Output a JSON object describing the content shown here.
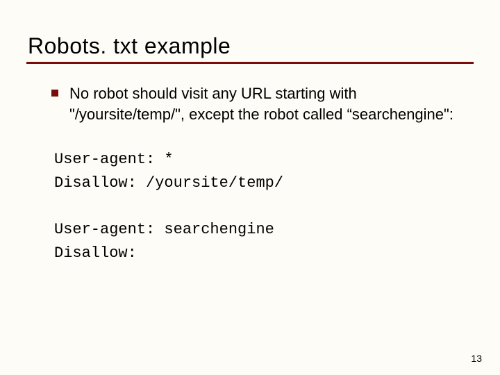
{
  "title": "Robots. txt example",
  "bullet": "No robot should visit any URL starting with \"/yoursite/temp/\", except the robot called “searchengine\":",
  "code": {
    "line1": "User-agent: *",
    "line2": "Disallow: /yoursite/temp/",
    "line3": "User-agent: searchengine",
    "line4": "Disallow:"
  },
  "page_number": "13"
}
